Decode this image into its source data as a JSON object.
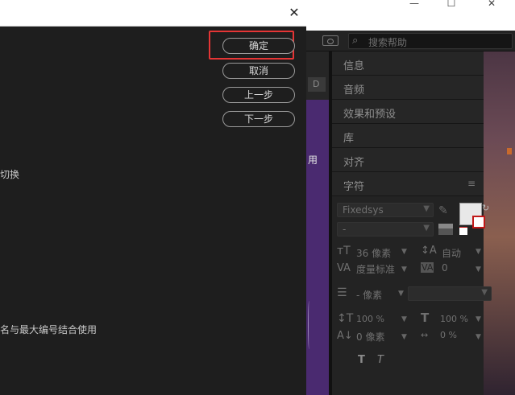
{
  "window_controls": {
    "minimize": "—",
    "maximize": "☐",
    "close": "✕"
  },
  "topbar": {
    "search_placeholder": "搜索帮助"
  },
  "middle": {
    "tab_label": "D",
    "clip_text": "用"
  },
  "panels": [
    "信息",
    "音频",
    "效果和预设",
    "库",
    "对齐",
    "字符"
  ],
  "character": {
    "font_family": "Fixedsys",
    "font_style": "-",
    "font_size": "36 像素",
    "leading": "自动",
    "kerning": "度量标准",
    "tracking": "0",
    "stroke_width": "- 像素",
    "vertical_scale": "100 %",
    "horizontal_scale": "100 %",
    "baseline_shift": "0 像素",
    "tsume": "0 %",
    "faux_bold": "T",
    "faux_italic": "T"
  },
  "dialog": {
    "close_label": "✕",
    "buttons": {
      "ok": "确定",
      "cancel": "取消",
      "previous": "上一步",
      "next": "下一步"
    },
    "text_toggle": "切换",
    "text_combine": "名与最大编号结合使用"
  }
}
